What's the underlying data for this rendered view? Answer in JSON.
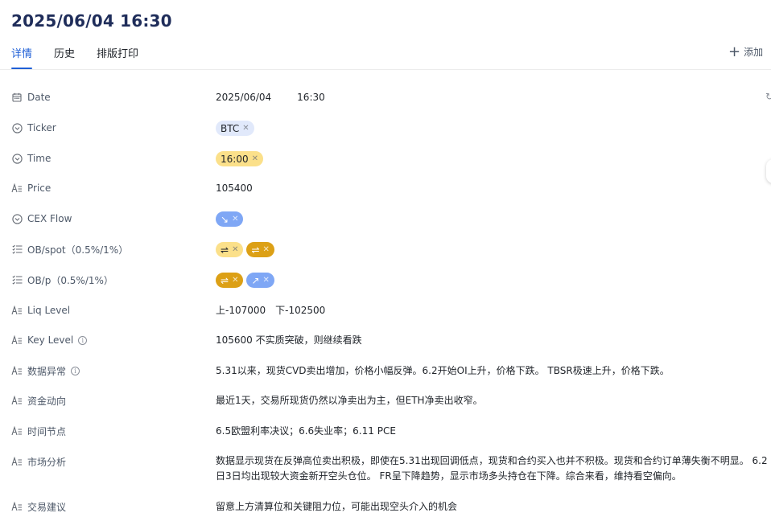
{
  "header": {
    "title": "2025/06/04 16:30"
  },
  "tabs": [
    {
      "label": "详情",
      "active": true
    },
    {
      "label": "历史",
      "active": false
    },
    {
      "label": "排版打印",
      "active": false
    }
  ],
  "actions": {
    "add_field_label": "添加"
  },
  "fields": {
    "date": {
      "label": "Date",
      "date": "2025/06/04",
      "time": "16:30"
    },
    "ticker": {
      "label": "Ticker",
      "tag": "BTC"
    },
    "time": {
      "label": "Time",
      "tag": "16:00"
    },
    "price": {
      "label": "Price",
      "value": "105400"
    },
    "cex_flow": {
      "label": "CEX Flow",
      "tag": "↘"
    },
    "ob_spot": {
      "label": "OB/spot（0.5%/1%）",
      "tags": [
        "⇌",
        "⇌"
      ]
    },
    "ob_p": {
      "label": "OB/p（0.5%/1%）",
      "tags": [
        "⇌",
        "↗"
      ]
    },
    "liq_level": {
      "label": "Liq Level",
      "value": "上-107000　下-102500"
    },
    "key_level": {
      "label": "Key Level",
      "value": "105600 不实质突破，则继续看跌"
    },
    "data_anomaly": {
      "label": "数据异常",
      "value": "5.31以来，现货CVD卖出增加，价格小幅反弹。6.2开始OI上升，价格下跌。 TBSR极速上升，价格下跌。"
    },
    "fund_flow": {
      "label": "资金动向",
      "value": "最近1天，交易所现货仍然以净卖出为主，但ETH净卖出收窄。"
    },
    "time_nodes": {
      "label": "时间节点",
      "value": "6.5欧盟利率决议；6.6失业率；6.11 PCE"
    },
    "market_analysis": {
      "label": "市场分析",
      "value": "数据显示现货在反弹高位卖出积极，即使在5.31出现回调低点，现货和合约买入也并不积极。现货和合约订单薄失衡不明显。 6.2日3日均出现较大资金新开空头仓位。 FR呈下降趋势，显示市场多头持仓在下降。综合来看，维持看空偏向。"
    },
    "trade_advice": {
      "label": "交易建议",
      "value": "留意上方清算位和关键阻力位，可能出现空头介入的机会"
    }
  },
  "colors": {
    "accent": "#1f5fd6",
    "title": "#1f2d5a",
    "tag_light_blue": "#e1e9fb",
    "tag_yellow": "#fbe08a",
    "tag_blue": "#7fa7f5",
    "tag_gold": "#dca016"
  },
  "icons": {
    "date": "calendar-icon",
    "single_select": "circle-chevron-icon",
    "text": "text-field-icon",
    "multi_select": "list-check-icon",
    "info": "info-icon"
  }
}
